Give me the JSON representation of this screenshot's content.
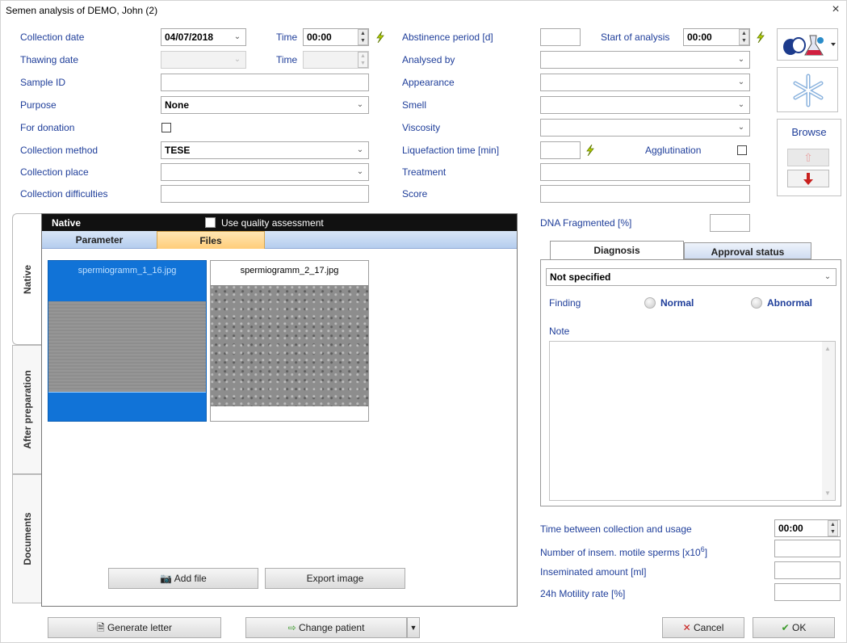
{
  "window": {
    "title": "Semen analysis of DEMO, John (2)",
    "close_glyph": "×"
  },
  "left_form": {
    "collection_date": {
      "label": "Collection date",
      "value": "04/07/2018",
      "time_label": "Time",
      "time_value": "00:00"
    },
    "thawing_date": {
      "label": "Thawing date",
      "value": "",
      "time_label": "Time",
      "time_value": ""
    },
    "sample_id": {
      "label": "Sample ID",
      "value": ""
    },
    "purpose": {
      "label": "Purpose",
      "value": "None"
    },
    "for_donation": {
      "label": "For donation",
      "checked": false
    },
    "collection_method": {
      "label": "Collection method",
      "value": "TESE"
    },
    "collection_place": {
      "label": "Collection place",
      "value": ""
    },
    "collection_difficulties": {
      "label": "Collection difficulties",
      "value": ""
    }
  },
  "middle_form": {
    "abstinence": {
      "label": "Abstinence period [d]",
      "value": ""
    },
    "start_of_analysis": {
      "label": "Start of analysis",
      "value": "00:00"
    },
    "analysed_by": {
      "label": "Analysed by",
      "value": ""
    },
    "appearance": {
      "label": "Appearance",
      "value": ""
    },
    "smell": {
      "label": "Smell",
      "value": ""
    },
    "viscosity": {
      "label": "Viscosity",
      "value": ""
    },
    "liquefaction": {
      "label": "Liquefaction time [min]",
      "value": ""
    },
    "agglutination": {
      "label": "Agglutination",
      "checked": false
    },
    "treatment": {
      "label": "Treatment",
      "value": ""
    },
    "score": {
      "label": "Score",
      "value": ""
    }
  },
  "right_tools": {
    "browse_label": "Browse",
    "up_arrow": "⇧",
    "down_arrow": "🡇"
  },
  "side_tabs": {
    "native": "Native",
    "after_preparation": "After preparation",
    "documents": "Documents"
  },
  "panel": {
    "header": "Native",
    "quality_label": "Use quality assessment",
    "tabs": [
      "Parameter",
      "Files"
    ],
    "active_tab": "Files",
    "files": [
      {
        "name": "spermiogramm_1_16.jpg",
        "selected": true
      },
      {
        "name": "spermiogramm_2_17.jpg",
        "selected": false
      }
    ],
    "add_file_label": "Add file",
    "export_image_label": "Export image"
  },
  "dna_fragmented": {
    "label": "DNA Fragmented [%]",
    "value": ""
  },
  "diagnosis": {
    "tabs": [
      "Diagnosis",
      "Approval status"
    ],
    "value": "Not specified",
    "finding_label": "Finding",
    "normal_label": "Normal",
    "abnormal_label": "Abnormal",
    "note_label": "Note",
    "note_value": ""
  },
  "bottom_right": {
    "time_between_label": "Time between collection and usage",
    "time_between_value": "00:00",
    "insem_motile_label": "Number of insem. motile sperms [x10",
    "insem_motile_sup": "6",
    "insem_motile_close": "]",
    "inseminated_amount_label": "Inseminated amount [ml]",
    "motility_rate_label": "24h Motility rate [%]"
  },
  "footer": {
    "generate_letter": "Generate letter",
    "change_patient": "Change patient",
    "cancel": "Cancel",
    "ok": "OK"
  },
  "colors": {
    "label_blue": "#1f3e9a",
    "selection_blue": "#1173d7",
    "accent_green": "#3a9a2a",
    "cancel_red": "#c8201e"
  }
}
